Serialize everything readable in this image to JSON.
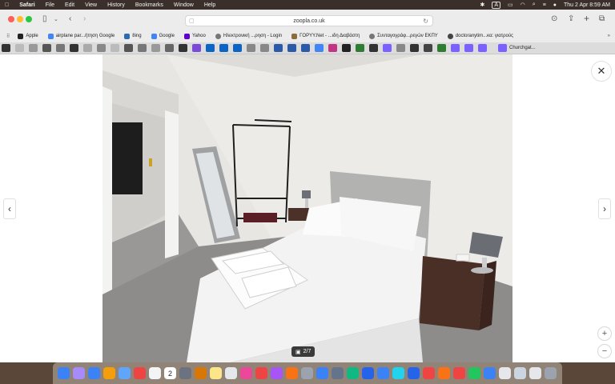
{
  "menubar": {
    "app_name": "Safari",
    "items": [
      "File",
      "Edit",
      "View",
      "History",
      "Bookmarks",
      "Window",
      "Help"
    ],
    "clock": "Thu 2 Apr  8:59 AM",
    "input_indicator": "A"
  },
  "browser": {
    "url": "zoopla.co.uk"
  },
  "favorites": [
    {
      "label": "Apple",
      "color": "#222222"
    },
    {
      "label": "airplane par...ήτηση Google",
      "color": "#4285f4"
    },
    {
      "label": "8ing",
      "color": "#2b6cb0"
    },
    {
      "label": "Google",
      "color": "#4285f4"
    },
    {
      "label": "Yahoo",
      "color": "#6001d2"
    },
    {
      "label": "Ηλεκτρονική ...ρηση - Login",
      "color": "#777777"
    },
    {
      "label": "ΓΟΡΥΥ.Net - ...ιδη Διαβάστη",
      "color": "#8a6d3b"
    },
    {
      "label": "Συνταγογράφ...ρεγών ΕΚΠΥ",
      "color": "#777777"
    },
    {
      "label": "doctoranytim...κα: γιατρούς",
      "color": "#444444"
    }
  ],
  "tab_colors": [
    "#333",
    "#bbb",
    "#999",
    "#555",
    "#777",
    "#333",
    "#aaa",
    "#888",
    "#bbb",
    "#555",
    "#777",
    "#999",
    "#666",
    "#333",
    "#7a4bd6",
    "#0a66c2",
    "#0a66c2",
    "#0a66c2",
    "#888",
    "#888",
    "#2b5ba8",
    "#2b5ba8",
    "#2b5ba8",
    "#4285f4",
    "#c13584",
    "#222",
    "#2e7d32",
    "#333",
    "#7b61ff",
    "#888",
    "#333",
    "#444",
    "#2e7d32",
    "#7b61ff",
    "#7b61ff",
    "#7b61ff"
  ],
  "last_tab": {
    "label": "Churchgat..."
  },
  "viewer": {
    "counter": "2/7",
    "prev_label": "‹",
    "next_label": "›",
    "close_label": "✕",
    "zoom_in_label": "+",
    "zoom_out_label": "−"
  },
  "dock_colors": [
    "#3b82f6",
    "#a78bfa",
    "#3b82f6",
    "#f59e0b",
    "#60a5fa",
    "#ef4444",
    "#f3f4f6",
    "#22c55e",
    "#6b7280",
    "#d97706",
    "#fde68a",
    "#e5e7eb",
    "#ec4899",
    "#ef4444",
    "#a855f7",
    "#f97316",
    "#9ca3af",
    "#3b82f6",
    "#64748b",
    "#10b981",
    "#2563eb",
    "#3b82f6",
    "#22d3ee",
    "#2563eb",
    "#ef4444",
    "#f97316",
    "#ef4444",
    "#22c55e",
    "#3b82f6",
    "#e5e7eb",
    "#cbd5e1",
    "#e5e7eb",
    "#9ca3af"
  ],
  "dock_date": "2"
}
